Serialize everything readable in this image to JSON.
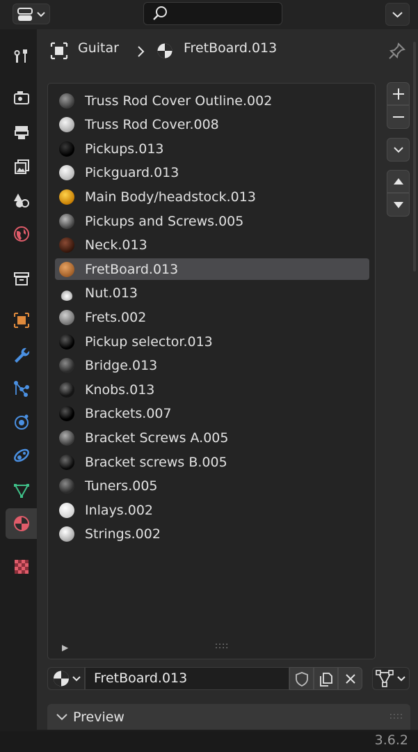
{
  "breadcrumb": {
    "object": "Guitar",
    "material": "FretBoard.013"
  },
  "materials": [
    {
      "label": "Truss Rod Cover Outline.002",
      "ball": "radial-gradient(circle at 40% 35%, #9a9a9a, #3a3a3a 70%)"
    },
    {
      "label": "Truss Rod Cover.008",
      "ball": "radial-gradient(circle at 40% 35%, #f5f5f5, #a8a8a8 75%)"
    },
    {
      "label": "Pickups.013",
      "ball": "radial-gradient(circle at 40% 35%, #3a3a3a, #000 65%)"
    },
    {
      "label": "Pickguard.013",
      "ball": "radial-gradient(circle at 40% 35%, #f8f8f8, #b5b5b5 75%)"
    },
    {
      "label": "Main Body/headstock.013",
      "ball": "radial-gradient(circle at 40% 35%, #ffd24a, #c47a00 75%)"
    },
    {
      "label": "Pickups and Screws.005",
      "ball": "radial-gradient(circle at 40% 35%, #bcbcbc, #3e3e3e 70%)"
    },
    {
      "label": "Neck.013",
      "ball": "radial-gradient(circle at 40% 35%, #8a4a34, #2e1208 75%)"
    },
    {
      "label": "FretBoard.013",
      "ball": "radial-gradient(circle at 40% 35%, #e6a262, #9c5a24 75%)"
    },
    {
      "label": "Nut.013",
      "ball": "radial-gradient(circle at 50% 70%, #ffffff, #bdbdbd 40%, transparent 45%)"
    },
    {
      "label": "Frets.002",
      "ball": "radial-gradient(circle at 40% 35%, #d0d0d0, #6a6a6a 75%)"
    },
    {
      "label": "Pickup selector.013",
      "ball": "radial-gradient(circle at 40% 35%, #5a5a5a, #000 65%)"
    },
    {
      "label": "Bridge.013",
      "ball": "radial-gradient(circle at 40% 35%, #8a8a8a, #2a2a2a 65%)"
    },
    {
      "label": "Knobs.013",
      "ball": "radial-gradient(circle at 40% 35%, #7a7a7a, #151515 60%)"
    },
    {
      "label": "Brackets.007",
      "ball": "radial-gradient(circle at 40% 35%, #555, #000 60%)"
    },
    {
      "label": "Bracket Screws A.005",
      "ball": "radial-gradient(circle at 40% 35%, #b0b0b0, #3a3a3a 70%)"
    },
    {
      "label": "Bracket screws B.005",
      "ball": "radial-gradient(circle at 40% 35%, #6c6c6c, #0a0a0a 65%)"
    },
    {
      "label": "Tuners.005",
      "ball": "radial-gradient(circle at 40% 35%, #8a8a8a, #2c2c2c 65%)"
    },
    {
      "label": "Inlays.002",
      "ball": "radial-gradient(circle at 40% 35%, #ffffff, #cfcfcf 75%)"
    },
    {
      "label": "Strings.002",
      "ball": "radial-gradient(circle at 40% 35%, #ffffff, #a0a0a0 80%)"
    }
  ],
  "selected_index": 7,
  "material_slot": {
    "name": "FretBoard.013"
  },
  "preview": {
    "label": "Preview"
  },
  "status": {
    "version": "3.6.2"
  },
  "colors": {
    "accent_orange": "#e08a3c",
    "accent_blue": "#4a90e2",
    "accent_green": "#3fc189",
    "accent_red": "#e05c6a",
    "selection": "#4a4a4d"
  },
  "tab_icons": [
    "tool-icon",
    "render-icon",
    "output-icon",
    "view-layer-icon",
    "scene-icon",
    "world-icon",
    "collection-icon",
    "object-icon",
    "modifier-icon",
    "particles-icon",
    "physics-icon",
    "constraints-icon",
    "data-icon",
    "material-icon",
    "texture-icon"
  ]
}
